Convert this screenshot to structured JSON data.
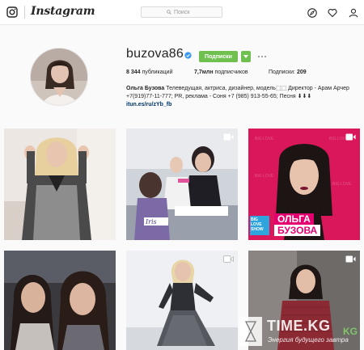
{
  "nav": {
    "brand": "Instagram",
    "search_placeholder": "Поиск",
    "icons": [
      "instagram-camera-icon",
      "search-icon",
      "explore-compass-icon",
      "heart-icon",
      "profile-icon"
    ]
  },
  "profile": {
    "username": "buzova86",
    "follow_label": "Подписки",
    "stats": {
      "posts_count": "8 344",
      "posts_label": "публикаций",
      "followers_count": "7,7млн",
      "followers_label": "подписчиков",
      "following_label": "Подписки:",
      "following_count": "209"
    },
    "bio": {
      "name": "Ольга Бузова",
      "text": "Телеведущая, актриса, дизайнер, модель⬚⬚ Директор - Арам Арчер +7(919)77-11-777; PR, реклама - Соня +7 (985) 913-55-65; Песня ⬇⬇⬇",
      "link": "itun.es/ru/zYb_fb"
    }
  },
  "posts": [
    {
      "id": "post-1",
      "video": false,
      "caption": ""
    },
    {
      "id": "post-2",
      "video": true,
      "caption": ""
    },
    {
      "id": "post-3",
      "video": true,
      "caption_line1": "ОЛЬГА",
      "caption_line2": "БУЗОВА",
      "badge": "BIG LOVE SHOW"
    },
    {
      "id": "post-4",
      "video": false,
      "caption": ""
    },
    {
      "id": "post-5",
      "video": true,
      "caption": ""
    },
    {
      "id": "post-6",
      "video": true,
      "caption": ""
    }
  ],
  "watermark": {
    "title": "TIME.KG",
    "tail": "KG",
    "subtitle": "Энергия будущего завтра"
  },
  "colors": {
    "follow_green": "#70c050",
    "verified_blue": "#3897f0",
    "link": "#003569",
    "magenta_bg": "#d9175a",
    "caption_pink": "#e4006e"
  }
}
